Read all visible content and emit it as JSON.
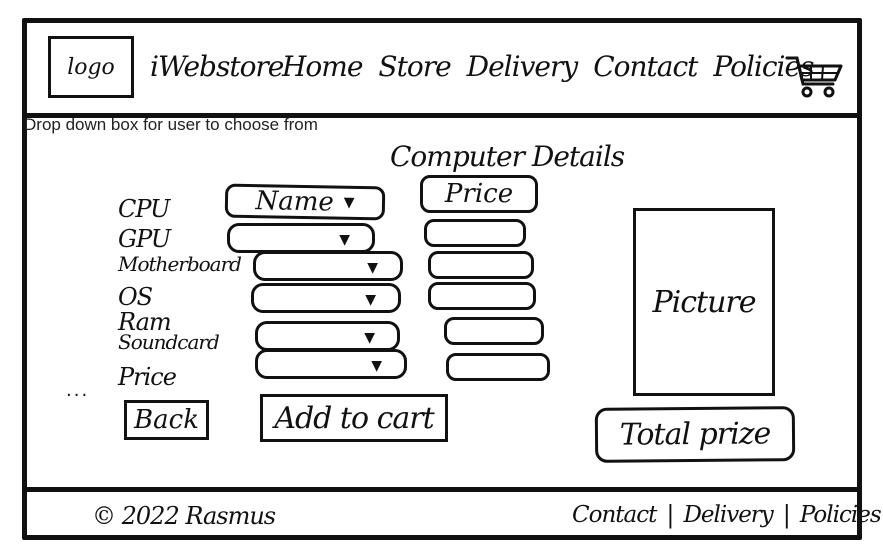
{
  "header": {
    "logo_label": "logo",
    "brand": "iWebstore",
    "nav": [
      {
        "label": "Home"
      },
      {
        "label": "Store"
      },
      {
        "label": "Delivery"
      },
      {
        "label": "Contact"
      },
      {
        "label": "Policies"
      }
    ],
    "cart_icon": "shopping-cart-icon"
  },
  "instruction": "Drop down box for user to choose from",
  "builder": {
    "title": "Computer Details",
    "components": [
      {
        "label": "CPU"
      },
      {
        "label": "GPU"
      },
      {
        "label": "Motherboard"
      },
      {
        "label": "OS"
      },
      {
        "label": "Ram"
      },
      {
        "label": "Soundcard"
      },
      {
        "label": "Price"
      }
    ],
    "name_header": "Name",
    "price_header": "Price",
    "ellipsis": "..."
  },
  "picture_label": "Picture",
  "actions": {
    "back": "Back",
    "add_to_cart": "Add to cart",
    "total": "Total prize"
  },
  "footer": {
    "copyright": "© 2022 Rasmus",
    "links": [
      {
        "label": "Contact"
      },
      {
        "label": "Delivery"
      },
      {
        "label": "Policies"
      }
    ]
  }
}
